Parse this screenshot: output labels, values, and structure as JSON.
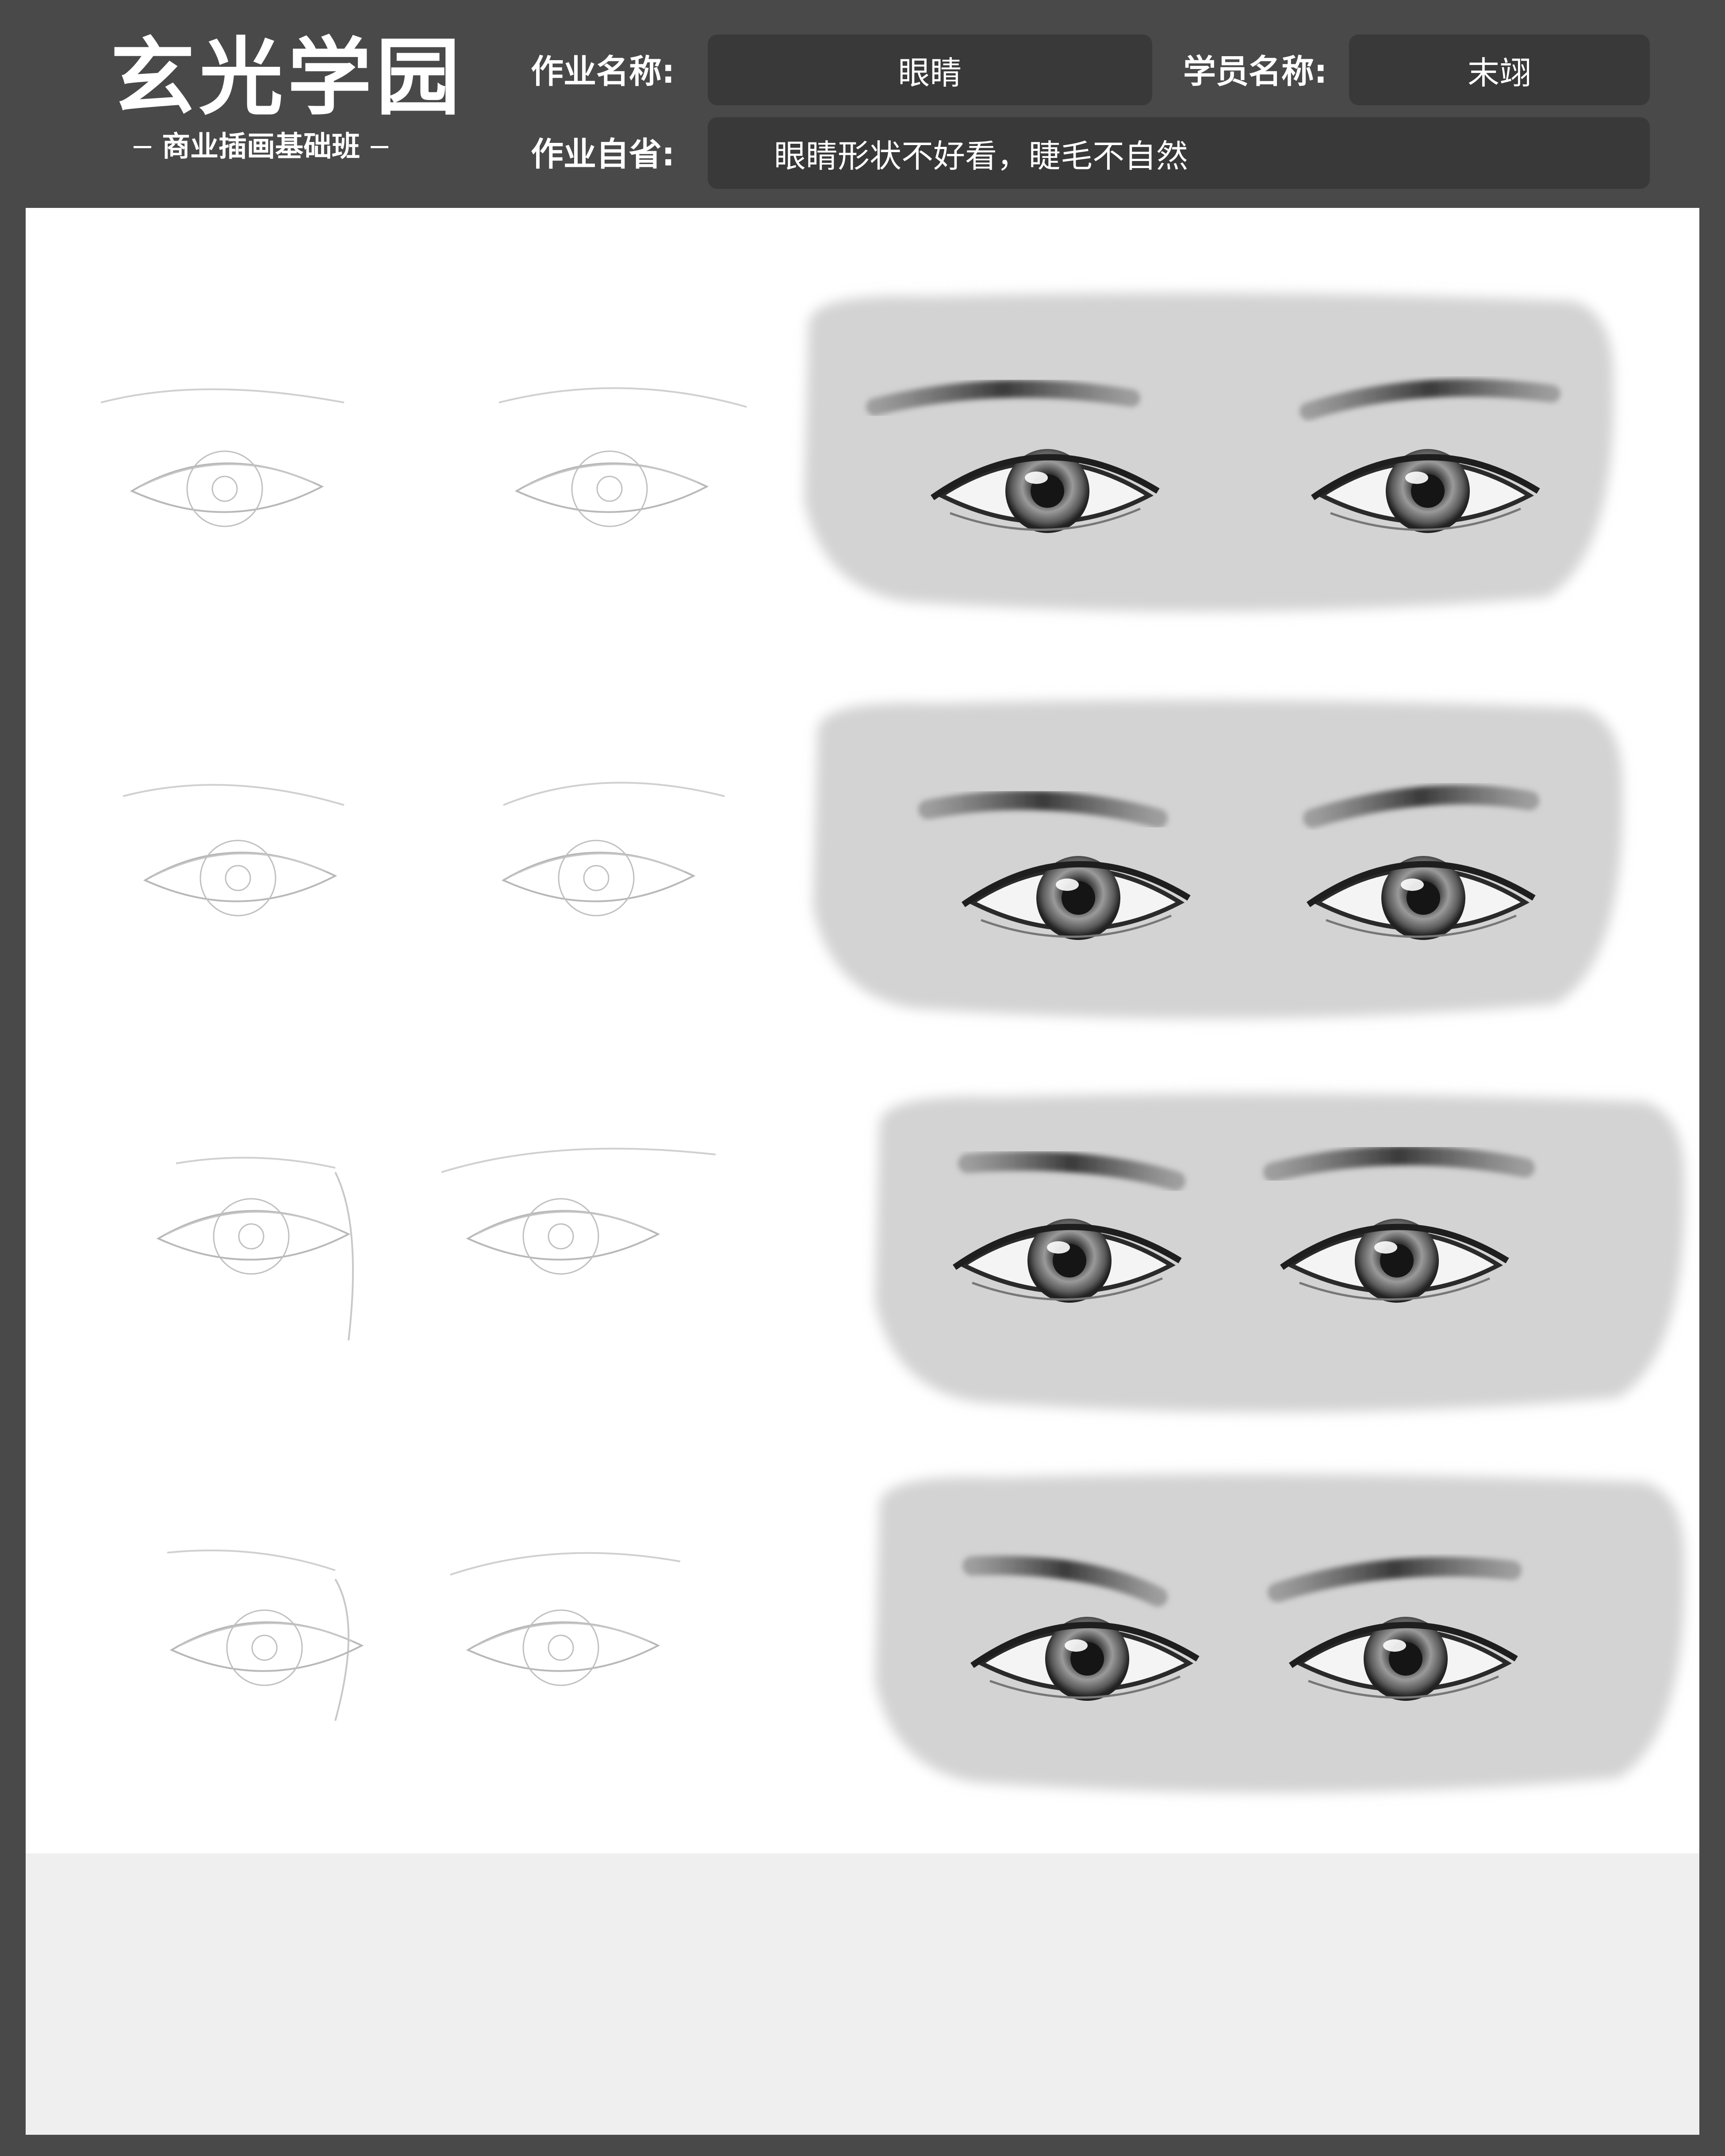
{
  "brand": {
    "title": "玄光学园",
    "subtitle": "商业插画基础班"
  },
  "form": {
    "assignment_label": "作业名称:",
    "assignment_value": "眼睛",
    "student_label": "学员名称:",
    "student_value": "末翊",
    "reflection_label": "作业自省:",
    "reflection_value": "眼睛形状不好看，睫毛不自然"
  },
  "colors": {
    "frame": "#4a494a",
    "field": "#3a393a",
    "paper": "#ffffff",
    "strip": "#efefef"
  }
}
